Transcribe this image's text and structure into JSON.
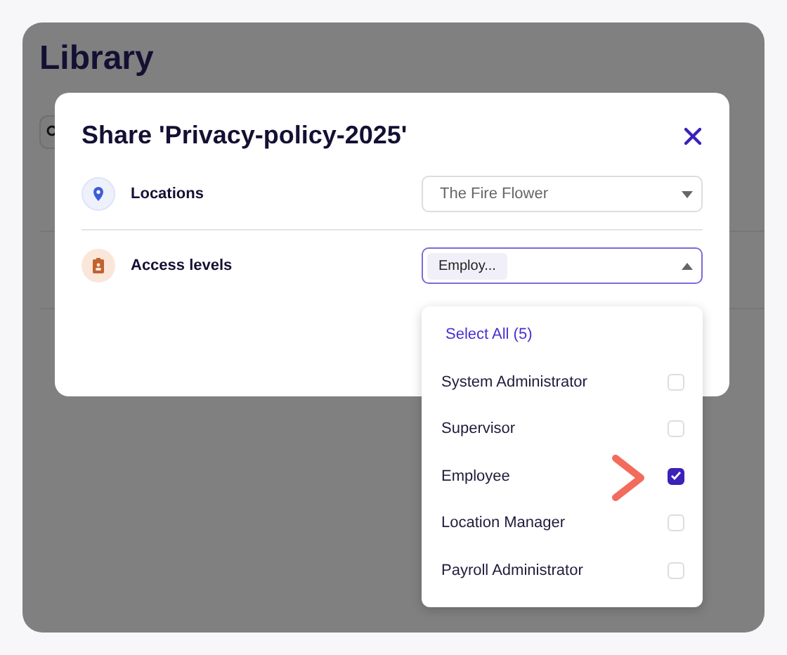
{
  "page": {
    "title": "Library"
  },
  "dialog": {
    "title": "Share 'Privacy-policy-2025'",
    "fields": [
      {
        "kind": "location",
        "label": "Locations",
        "value": "The Fire Flower",
        "open": false
      },
      {
        "kind": "access",
        "label": "Access levels",
        "chip": "Employ...",
        "open": true
      }
    ]
  },
  "dropdown": {
    "select_all": "Select All (5)",
    "options": [
      {
        "label": "System Administrator",
        "checked": false
      },
      {
        "label": "Supervisor",
        "checked": false
      },
      {
        "label": "Employee",
        "checked": true
      },
      {
        "label": "Location Manager",
        "checked": false
      },
      {
        "label": "Payroll Administrator",
        "checked": false
      }
    ]
  }
}
